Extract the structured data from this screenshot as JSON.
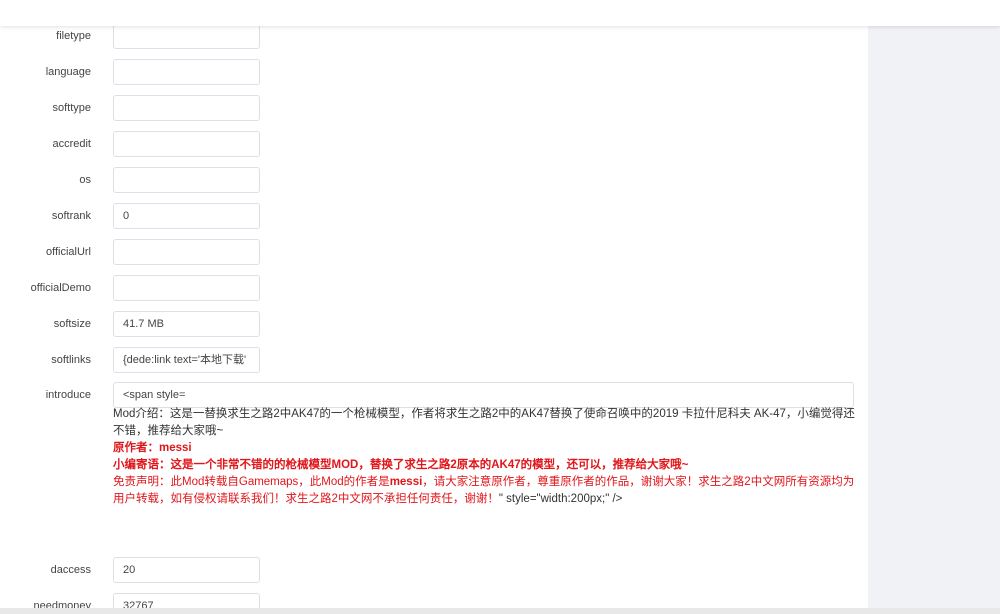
{
  "fields": [
    {
      "label": "filetype",
      "value": ""
    },
    {
      "label": "language",
      "value": ""
    },
    {
      "label": "softtype",
      "value": ""
    },
    {
      "label": "accredit",
      "value": ""
    },
    {
      "label": "os",
      "value": ""
    },
    {
      "label": "softrank",
      "value": "0"
    },
    {
      "label": "officialUrl",
      "value": ""
    },
    {
      "label": "officialDemo",
      "value": ""
    },
    {
      "label": "softsize",
      "value": "41.7 MB"
    },
    {
      "label": "softlinks",
      "value": "{dede:link text='本地下载'"
    }
  ],
  "introduce": {
    "label": "introduce",
    "value": "<span style=",
    "description": "Mod介绍：这是一替换求生之路2中AK47的一个枪械模型，作者将求生之路2中的AK47替换了使命召唤中的2019 卡拉什尼科夫 AK-47，小编觉得还不错，推荐给大家哦~",
    "author": "原作者：messi",
    "editor_note": "小编寄语：这是一个非常不错的的枪械模型MOD，替换了求生之路2原本的AK47的模型，还可以，推荐给大家哦~",
    "disclaimer_a": "免责声明：此Mod转载自Gamemaps，此Mod的作者是",
    "disclaimer_author": "messi",
    "disclaimer_b": "，请大家注意原作者，尊重原作者的作品，谢谢大家！求生之路2中文网所有资源均为用户转载，如有侵权请联系我们！求生之路2中文网不承担任何责任，谢谢！",
    "disclaimer_tail": "\" style=\"width:200px;\" />"
  },
  "fields_bottom": [
    {
      "label": "daccess",
      "value": "20"
    },
    {
      "label": "needmoney",
      "value": "32767"
    }
  ]
}
